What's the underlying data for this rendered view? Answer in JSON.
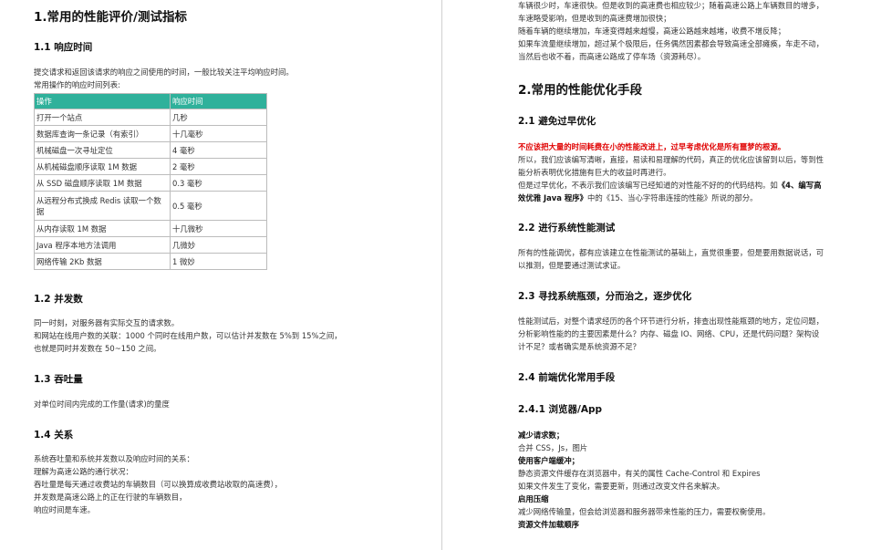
{
  "left": {
    "h1": "1.常用的性能评价/测试指标",
    "s11": {
      "title": "1.1  响应时间",
      "p1": "提交请求和返回该请求的响应之间使用的时间，一般比较关注平均响应时间。",
      "p2": "常用操作的响应时间列表:",
      "table": {
        "headers": [
          "操作",
          "响应时间"
        ],
        "rows": [
          [
            "打开一个站点",
            "几秒"
          ],
          [
            "数据库查询一条记录（有索引）",
            "十几毫秒"
          ],
          [
            "机械磁盘一次寻址定位",
            "4 毫秒"
          ],
          [
            "从机械磁盘顺序读取 1M 数据",
            "2 毫秒"
          ],
          [
            "从 SSD 磁盘顺序读取 1M 数据",
            "0.3 毫秒"
          ],
          [
            "从远程分布式换成 Redis 读取一个数据",
            "0.5 毫秒"
          ],
          [
            "从内存读取 1M 数据",
            "十几微秒"
          ],
          [
            "Java 程序本地方法调用",
            "几微妙"
          ],
          [
            "网络传输 2Kb 数据",
            "1 微妙"
          ]
        ]
      }
    },
    "s12": {
      "title": "1.2 并发数",
      "lines": [
        "同一时刻，对服务器有实际交互的请求数。",
        "和网站在线用户数的关联：1000 个同时在线用户数，可以估计并发数在 5%到 15%之间，",
        "也就是同时并发数在 50~150 之间。"
      ]
    },
    "s13": {
      "title": "1.3 吞吐量",
      "line": "对单位时间内完成的工作量(请求)的量度"
    },
    "s14": {
      "title": "1.4 关系",
      "lines": [
        "系统吞吐量和系统并发数以及响应时间的关系：",
        "理解为高速公路的通行状况：",
        "吞吐量是每天通过收费站的车辆数目（可以换算成收费站收取的高速费），",
        "并发数是高速公路上的正在行驶的车辆数目，",
        "响应时间是车速。"
      ]
    }
  },
  "right": {
    "intro_lines": [
      "车辆很少时，车速很快。但是收到的高速费也相应较少；随着高速公路上车辆数目的增多，",
      "车速略受影响，但是收到的高速费增加很快；",
      "随着车辆的继续增加，车速变得越来越慢，高速公路越来越堵，收费不增反降；",
      "如果车流量继续增加，超过某个极限后，任务偶然因素都会导致高速全部瘫痪，车走不动，",
      "当然后也收不着，而高速公路成了停车场（资源耗尽）。"
    ],
    "h1": "2.常用的性能优化手段",
    "s21": {
      "title": "2.1 避免过早优化",
      "red": "不应该把大量的时间耗费在小的性能改进上，过早考虑优化是所有噩梦的根源。",
      "lines": [
        "所以，我们应该编写清晰，直接，易读和易理解的代码，真正的优化应该留到以后，等到性",
        "能分析表明优化措施有巨大的收益时再进行。"
      ],
      "line3_prefix": "但是过早优化，不表示我们应该编写已经知道的对性能不好的的代码结构。如",
      "line3_bold": "《4、编写高",
      "line4_bold": "效优雅 Java 程序》",
      "line4_rest": "中的《15、当心字符串连接的性能》所说的部分。"
    },
    "s22": {
      "title": "2.2 进行系统性能测试",
      "lines": [
        "所有的性能调优，都有应该建立在性能测试的基础上，直觉很重要，但是要用数据说话，可",
        "以推测，但是要通过测试求证。"
      ]
    },
    "s23": {
      "title": "2.3 寻找系统瓶颈，分而治之，逐步优化",
      "lines": [
        "性能测试后，对整个请求经历的各个环节进行分析，排查出现性能瓶颈的地方，定位问题，",
        "分析影响性能的的主要因素是什么？内存、磁盘 IO、网络、CPU，还是代码问题？架构设",
        "计不足？或者确实是系统资源不足？"
      ]
    },
    "s24": {
      "title": "2.4 前端优化常用手段",
      "sub": "2.4.1 浏览器/App",
      "items": [
        {
          "label": "减少请求数；",
          "desc": "合并 CSS，Js，图片"
        },
        {
          "label": "使用客户端缓冲；",
          "desc": "静态资源文件缓存在浏览器中，有关的属性 Cache-Control 和 Expires"
        },
        {
          "label": "",
          "desc": "如果文件发生了变化，需要更新，则通过改变文件名来解决。"
        },
        {
          "label": "启用压缩",
          "desc": "减少网络传输量，但会给浏览器和服务器带来性能的压力，需要权衡使用。"
        },
        {
          "label": "资源文件加载顺序",
          "desc": ""
        }
      ]
    }
  }
}
